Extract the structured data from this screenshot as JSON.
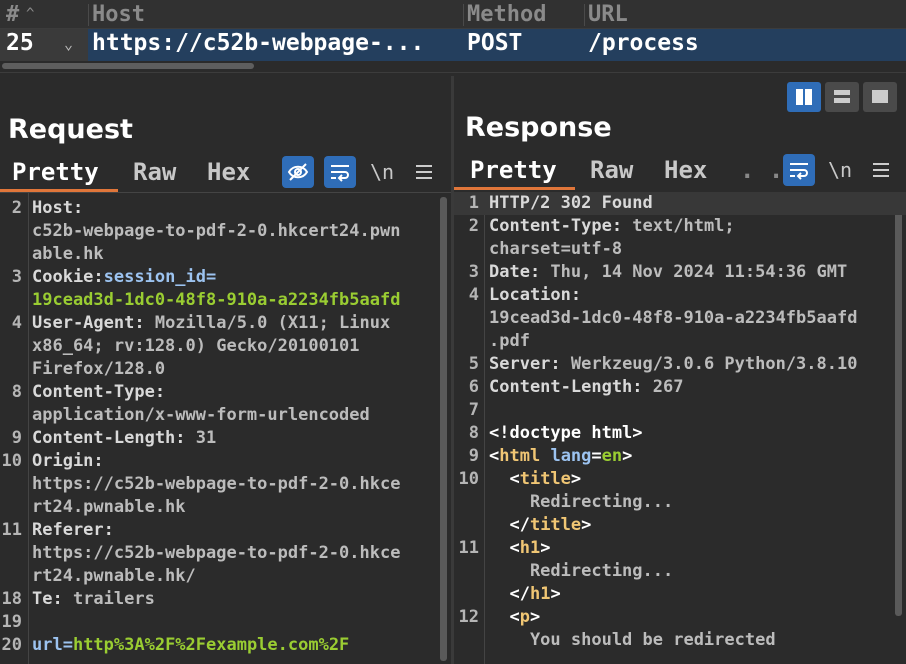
{
  "history_table": {
    "columns": [
      "#",
      "Host",
      "Method",
      "URL"
    ],
    "row": {
      "num": "25",
      "host": "https://c52b-webpage-...",
      "method": "POST",
      "url": "/process"
    }
  },
  "request": {
    "title": "Request",
    "tabs": [
      "Pretty",
      "Raw",
      "Hex"
    ],
    "newline_label": "\\n",
    "lines": [
      {
        "ln": "2",
        "key": "Host:",
        "val": ""
      },
      {
        "ln": "",
        "key": "",
        "val": "c52b-webpage-to-pdf-2-0.hkcert24.pwn"
      },
      {
        "ln": "",
        "key": "",
        "val": "able.hk"
      },
      {
        "ln": "3",
        "key": "Cookie:",
        "ck": "session_id=",
        "val": ""
      },
      {
        "ln": "",
        "key": "",
        "cv": "19cead3d-1dc0-48f8-910a-a2234fb5aafd"
      },
      {
        "ln": "4",
        "key": "User-Agent:",
        "val": " Mozilla/5.0 (X11; Linux"
      },
      {
        "ln": "",
        "key": "",
        "val": "x86_64; rv:128.0) Gecko/20100101"
      },
      {
        "ln": "",
        "key": "",
        "val": "Firefox/128.0"
      },
      {
        "ln": "8",
        "key": "Content-Type:",
        "val": ""
      },
      {
        "ln": "",
        "key": "",
        "val": "application/x-www-form-urlencoded"
      },
      {
        "ln": "9",
        "key": "Content-Length:",
        "val": " 31"
      },
      {
        "ln": "10",
        "key": "Origin:",
        "val": ""
      },
      {
        "ln": "",
        "key": "",
        "val": "https://c52b-webpage-to-pdf-2-0.hkce"
      },
      {
        "ln": "",
        "key": "",
        "val": "rt24.pwnable.hk"
      },
      {
        "ln": "11",
        "key": "Referer:",
        "val": ""
      },
      {
        "ln": "",
        "key": "",
        "val": "https://c52b-webpage-to-pdf-2-0.hkce"
      },
      {
        "ln": "",
        "key": "",
        "val": "rt24.pwnable.hk/"
      },
      {
        "ln": "18",
        "key": "Te:",
        "val": " trailers"
      },
      {
        "ln": "19",
        "key": "",
        "val": ""
      },
      {
        "ln": "20",
        "ck": "url=",
        "cv": "http%3A%2F%2Fexample.com%2F"
      }
    ]
  },
  "response": {
    "title": "Response",
    "tabs": [
      "Pretty",
      "Raw",
      "Hex"
    ],
    "overflow_tab": ". .",
    "newline_label": "\\n",
    "lines": [
      {
        "ln": "1",
        "key": "HTTP/2 302 Found",
        "val": "",
        "hl": true
      },
      {
        "ln": "2",
        "key": "Content-Type:",
        "val": " text/html;"
      },
      {
        "ln": "",
        "key": "",
        "val": "charset=utf-8"
      },
      {
        "ln": "3",
        "key": "Date:",
        "val": " Thu, 14 Nov 2024 11:54:36 GMT"
      },
      {
        "ln": "4",
        "key": "Location:",
        "val": ""
      },
      {
        "ln": "",
        "key": "",
        "val": "19cead3d-1dc0-48f8-910a-a2234fb5aafd"
      },
      {
        "ln": "",
        "key": "",
        "val": ".pdf"
      },
      {
        "ln": "5",
        "key": "Server:",
        "val": " Werkzeug/3.0.6 Python/3.8.10"
      },
      {
        "ln": "6",
        "key": "Content-Length:",
        "val": " 267"
      },
      {
        "ln": "7",
        "key": "",
        "val": ""
      },
      {
        "ln": "8",
        "html": [
          [
            "tag",
            "<!doctype html>"
          ]
        ]
      },
      {
        "ln": "9",
        "html": [
          [
            "tag",
            "<"
          ],
          [
            "tagname",
            "html"
          ],
          [
            "tag",
            " "
          ],
          [
            "attr",
            "lang"
          ],
          [
            "tag",
            "="
          ],
          [
            "attrv",
            "en"
          ],
          [
            "tag",
            ">"
          ]
        ]
      },
      {
        "ln": "10",
        "html": [
          [
            "tag",
            "  <"
          ],
          [
            "tagname",
            "title"
          ],
          [
            "tag",
            ">"
          ]
        ]
      },
      {
        "ln": "",
        "html": [
          [
            "v",
            "    Redirecting..."
          ]
        ]
      },
      {
        "ln": "",
        "html": [
          [
            "tag",
            "  </"
          ],
          [
            "tagname",
            "title"
          ],
          [
            "tag",
            ">"
          ]
        ]
      },
      {
        "ln": "11",
        "html": [
          [
            "tag",
            "  <"
          ],
          [
            "tagname",
            "h1"
          ],
          [
            "tag",
            ">"
          ]
        ]
      },
      {
        "ln": "",
        "html": [
          [
            "v",
            "    Redirecting..."
          ]
        ]
      },
      {
        "ln": "",
        "html": [
          [
            "tag",
            "  </"
          ],
          [
            "tagname",
            "h1"
          ],
          [
            "tag",
            ">"
          ]
        ]
      },
      {
        "ln": "12",
        "html": [
          [
            "tag",
            "  <"
          ],
          [
            "tagname",
            "p"
          ],
          [
            "tag",
            ">"
          ]
        ]
      },
      {
        "ln": "",
        "html": [
          [
            "v",
            "    You should be redirected"
          ]
        ]
      }
    ]
  },
  "colors": {
    "accent": "#2f6db8",
    "tab_underline": "#e0763a",
    "selected_row": "#243f5e"
  }
}
